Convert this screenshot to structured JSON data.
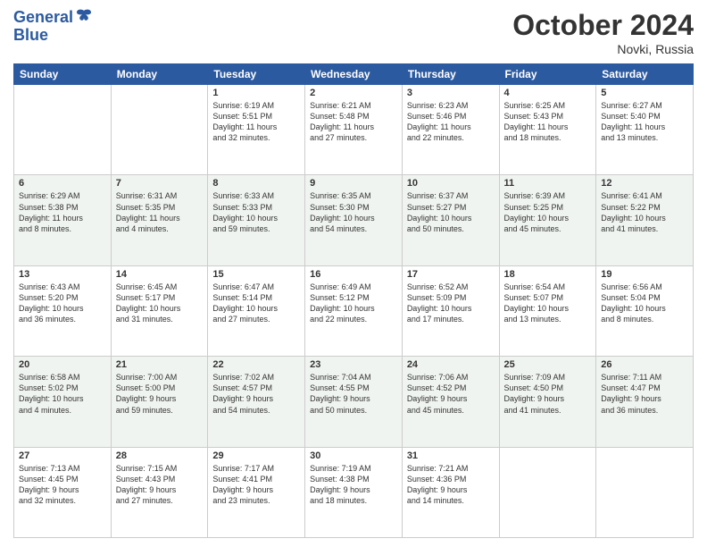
{
  "header": {
    "logo_line1": "General",
    "logo_line2": "Blue",
    "month_title": "October 2024",
    "location": "Novki, Russia"
  },
  "weekdays": [
    "Sunday",
    "Monday",
    "Tuesday",
    "Wednesday",
    "Thursday",
    "Friday",
    "Saturday"
  ],
  "weeks": [
    [
      {
        "day": "",
        "info": ""
      },
      {
        "day": "",
        "info": ""
      },
      {
        "day": "1",
        "info": "Sunrise: 6:19 AM\nSunset: 5:51 PM\nDaylight: 11 hours\nand 32 minutes."
      },
      {
        "day": "2",
        "info": "Sunrise: 6:21 AM\nSunset: 5:48 PM\nDaylight: 11 hours\nand 27 minutes."
      },
      {
        "day": "3",
        "info": "Sunrise: 6:23 AM\nSunset: 5:46 PM\nDaylight: 11 hours\nand 22 minutes."
      },
      {
        "day": "4",
        "info": "Sunrise: 6:25 AM\nSunset: 5:43 PM\nDaylight: 11 hours\nand 18 minutes."
      },
      {
        "day": "5",
        "info": "Sunrise: 6:27 AM\nSunset: 5:40 PM\nDaylight: 11 hours\nand 13 minutes."
      }
    ],
    [
      {
        "day": "6",
        "info": "Sunrise: 6:29 AM\nSunset: 5:38 PM\nDaylight: 11 hours\nand 8 minutes."
      },
      {
        "day": "7",
        "info": "Sunrise: 6:31 AM\nSunset: 5:35 PM\nDaylight: 11 hours\nand 4 minutes."
      },
      {
        "day": "8",
        "info": "Sunrise: 6:33 AM\nSunset: 5:33 PM\nDaylight: 10 hours\nand 59 minutes."
      },
      {
        "day": "9",
        "info": "Sunrise: 6:35 AM\nSunset: 5:30 PM\nDaylight: 10 hours\nand 54 minutes."
      },
      {
        "day": "10",
        "info": "Sunrise: 6:37 AM\nSunset: 5:27 PM\nDaylight: 10 hours\nand 50 minutes."
      },
      {
        "day": "11",
        "info": "Sunrise: 6:39 AM\nSunset: 5:25 PM\nDaylight: 10 hours\nand 45 minutes."
      },
      {
        "day": "12",
        "info": "Sunrise: 6:41 AM\nSunset: 5:22 PM\nDaylight: 10 hours\nand 41 minutes."
      }
    ],
    [
      {
        "day": "13",
        "info": "Sunrise: 6:43 AM\nSunset: 5:20 PM\nDaylight: 10 hours\nand 36 minutes."
      },
      {
        "day": "14",
        "info": "Sunrise: 6:45 AM\nSunset: 5:17 PM\nDaylight: 10 hours\nand 31 minutes."
      },
      {
        "day": "15",
        "info": "Sunrise: 6:47 AM\nSunset: 5:14 PM\nDaylight: 10 hours\nand 27 minutes."
      },
      {
        "day": "16",
        "info": "Sunrise: 6:49 AM\nSunset: 5:12 PM\nDaylight: 10 hours\nand 22 minutes."
      },
      {
        "day": "17",
        "info": "Sunrise: 6:52 AM\nSunset: 5:09 PM\nDaylight: 10 hours\nand 17 minutes."
      },
      {
        "day": "18",
        "info": "Sunrise: 6:54 AM\nSunset: 5:07 PM\nDaylight: 10 hours\nand 13 minutes."
      },
      {
        "day": "19",
        "info": "Sunrise: 6:56 AM\nSunset: 5:04 PM\nDaylight: 10 hours\nand 8 minutes."
      }
    ],
    [
      {
        "day": "20",
        "info": "Sunrise: 6:58 AM\nSunset: 5:02 PM\nDaylight: 10 hours\nand 4 minutes."
      },
      {
        "day": "21",
        "info": "Sunrise: 7:00 AM\nSunset: 5:00 PM\nDaylight: 9 hours\nand 59 minutes."
      },
      {
        "day": "22",
        "info": "Sunrise: 7:02 AM\nSunset: 4:57 PM\nDaylight: 9 hours\nand 54 minutes."
      },
      {
        "day": "23",
        "info": "Sunrise: 7:04 AM\nSunset: 4:55 PM\nDaylight: 9 hours\nand 50 minutes."
      },
      {
        "day": "24",
        "info": "Sunrise: 7:06 AM\nSunset: 4:52 PM\nDaylight: 9 hours\nand 45 minutes."
      },
      {
        "day": "25",
        "info": "Sunrise: 7:09 AM\nSunset: 4:50 PM\nDaylight: 9 hours\nand 41 minutes."
      },
      {
        "day": "26",
        "info": "Sunrise: 7:11 AM\nSunset: 4:47 PM\nDaylight: 9 hours\nand 36 minutes."
      }
    ],
    [
      {
        "day": "27",
        "info": "Sunrise: 7:13 AM\nSunset: 4:45 PM\nDaylight: 9 hours\nand 32 minutes."
      },
      {
        "day": "28",
        "info": "Sunrise: 7:15 AM\nSunset: 4:43 PM\nDaylight: 9 hours\nand 27 minutes."
      },
      {
        "day": "29",
        "info": "Sunrise: 7:17 AM\nSunset: 4:41 PM\nDaylight: 9 hours\nand 23 minutes."
      },
      {
        "day": "30",
        "info": "Sunrise: 7:19 AM\nSunset: 4:38 PM\nDaylight: 9 hours\nand 18 minutes."
      },
      {
        "day": "31",
        "info": "Sunrise: 7:21 AM\nSunset: 4:36 PM\nDaylight: 9 hours\nand 14 minutes."
      },
      {
        "day": "",
        "info": ""
      },
      {
        "day": "",
        "info": ""
      }
    ]
  ]
}
